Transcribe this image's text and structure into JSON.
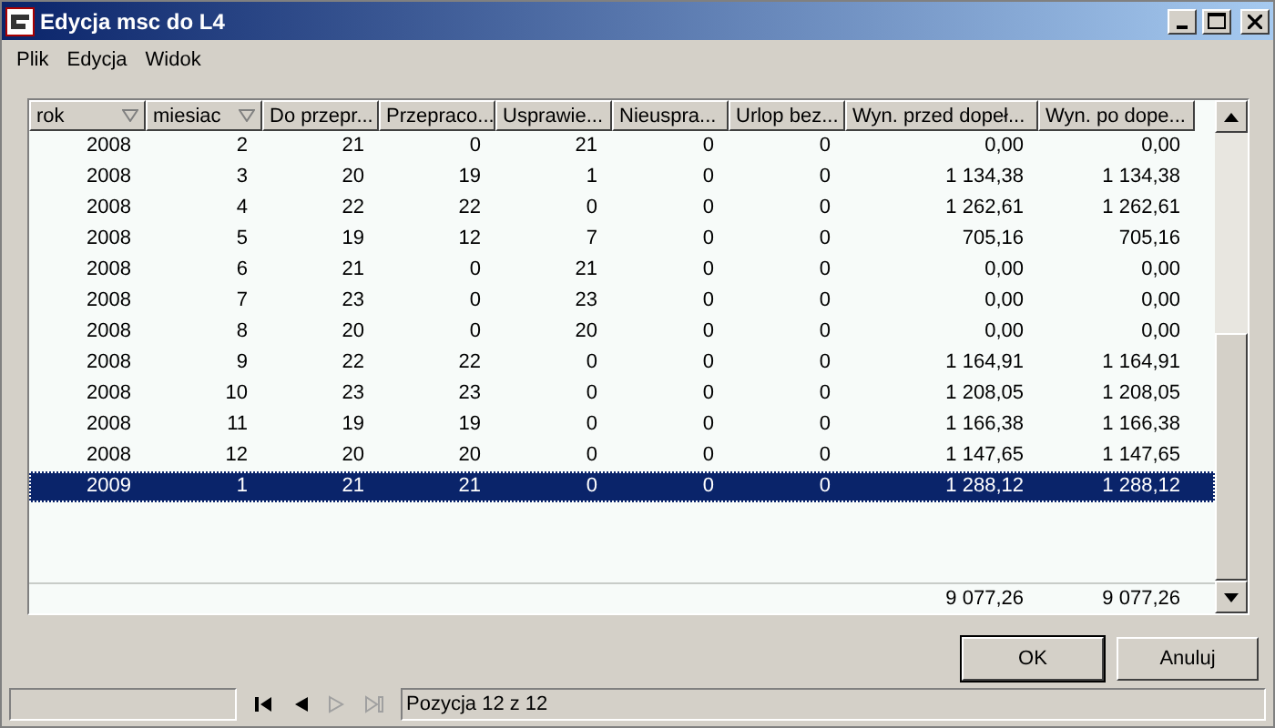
{
  "window": {
    "title": "Edycja msc do L4"
  },
  "menu": [
    {
      "label": "Plik"
    },
    {
      "label": "Edycja"
    },
    {
      "label": "Widok"
    }
  ],
  "table": {
    "columns": [
      {
        "label": "rok",
        "sortable": true
      },
      {
        "label": "miesiac",
        "sortable": true
      },
      {
        "label": "Do przepr..."
      },
      {
        "label": "Przepraco..."
      },
      {
        "label": "Usprawie..."
      },
      {
        "label": "Nieuspra..."
      },
      {
        "label": "Urlop bez..."
      },
      {
        "label": "Wyn. przed dopeł..."
      },
      {
        "label": "Wyn. po dope..."
      }
    ],
    "rows": [
      {
        "cells": [
          "2008",
          "2",
          "21",
          "0",
          "21",
          "0",
          "0",
          "0,00",
          "0,00"
        ],
        "selected": false
      },
      {
        "cells": [
          "2008",
          "3",
          "20",
          "19",
          "1",
          "0",
          "0",
          "1 134,38",
          "1 134,38"
        ],
        "selected": false
      },
      {
        "cells": [
          "2008",
          "4",
          "22",
          "22",
          "0",
          "0",
          "0",
          "1 262,61",
          "1 262,61"
        ],
        "selected": false
      },
      {
        "cells": [
          "2008",
          "5",
          "19",
          "12",
          "7",
          "0",
          "0",
          "705,16",
          "705,16"
        ],
        "selected": false
      },
      {
        "cells": [
          "2008",
          "6",
          "21",
          "0",
          "21",
          "0",
          "0",
          "0,00",
          "0,00"
        ],
        "selected": false
      },
      {
        "cells": [
          "2008",
          "7",
          "23",
          "0",
          "23",
          "0",
          "0",
          "0,00",
          "0,00"
        ],
        "selected": false
      },
      {
        "cells": [
          "2008",
          "8",
          "20",
          "0",
          "20",
          "0",
          "0",
          "0,00",
          "0,00"
        ],
        "selected": false
      },
      {
        "cells": [
          "2008",
          "9",
          "22",
          "22",
          "0",
          "0",
          "0",
          "1 164,91",
          "1 164,91"
        ],
        "selected": false
      },
      {
        "cells": [
          "2008",
          "10",
          "23",
          "23",
          "0",
          "0",
          "0",
          "1 208,05",
          "1 208,05"
        ],
        "selected": false
      },
      {
        "cells": [
          "2008",
          "11",
          "19",
          "19",
          "0",
          "0",
          "0",
          "1 166,38",
          "1 166,38"
        ],
        "selected": false
      },
      {
        "cells": [
          "2008",
          "12",
          "20",
          "20",
          "0",
          "0",
          "0",
          "1 147,65",
          "1 147,65"
        ],
        "selected": false
      },
      {
        "cells": [
          "2009",
          "1",
          "21",
          "21",
          "0",
          "0",
          "0",
          "1 288,12",
          "1 288,12"
        ],
        "selected": true
      }
    ],
    "totals": [
      "9 077,26",
      "9 077,26"
    ]
  },
  "buttons": [
    {
      "label": "OK",
      "default": true
    },
    {
      "label": "Anuluj",
      "default": false
    }
  ],
  "status_bar": {
    "navigation": [
      {
        "kind": "first",
        "disabled": false
      },
      {
        "kind": "prev",
        "disabled": false
      },
      {
        "kind": "next",
        "disabled": true
      },
      {
        "kind": "last",
        "disabled": true
      }
    ],
    "position": "Pozycja 12 z 12"
  }
}
